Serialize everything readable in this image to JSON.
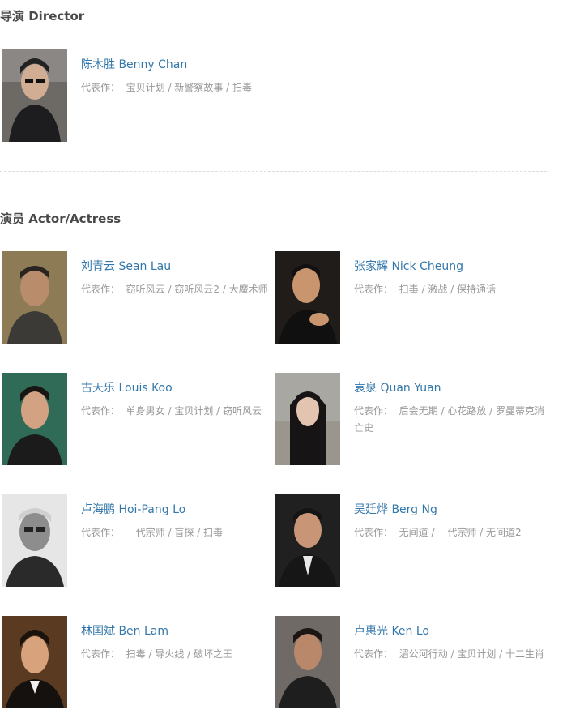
{
  "director_section": {
    "title": "导演 Director",
    "people": [
      {
        "name": "陈木胜 Benny Chan",
        "works_label": "代表作：",
        "works": "宝贝计划 / 新警察故事 / 扫毒"
      }
    ]
  },
  "actor_section": {
    "title": "演员 Actor/Actress",
    "people": [
      {
        "name": "刘青云 Sean Lau",
        "works_label": "代表作：",
        "works": "窃听风云 / 窃听风云2 / 大魔术师"
      },
      {
        "name": "张家辉 Nick Cheung",
        "works_label": "代表作：",
        "works": "扫毒 / 激战 / 保持通话"
      },
      {
        "name": "古天乐 Louis Koo",
        "works_label": "代表作：",
        "works": "单身男女 / 宝贝计划 / 窃听风云"
      },
      {
        "name": "袁泉 Quan Yuan",
        "works_label": "代表作：",
        "works": "后会无期 / 心花路放 / 罗曼蒂克消亡史"
      },
      {
        "name": "卢海鹏 Hoi-Pang Lo",
        "works_label": "代表作：",
        "works": "一代宗师 / 盲探 / 扫毒"
      },
      {
        "name": "吴廷烨 Berg Ng",
        "works_label": "代表作：",
        "works": "无间道 / 一代宗师 / 无间道2"
      },
      {
        "name": "林国斌 Ben Lam",
        "works_label": "代表作：",
        "works": "扫毒 / 导火线 / 破坏之王"
      },
      {
        "name": "卢惠光 Ken Lo",
        "works_label": "代表作：",
        "works": "湄公河行动 / 宝贝计划 / 十二生肖"
      }
    ]
  }
}
